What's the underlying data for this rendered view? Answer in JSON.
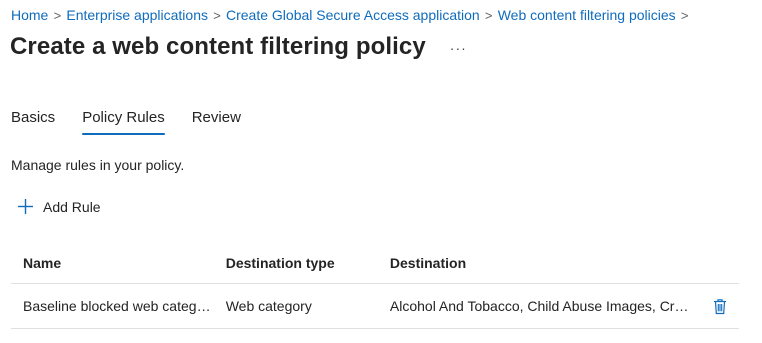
{
  "breadcrumb": {
    "items": [
      "Home",
      "Enterprise applications",
      "Create Global Secure Access application",
      "Web content filtering policies"
    ],
    "separator": ">"
  },
  "page": {
    "title": "Create a web content filtering policy",
    "more_label": "···"
  },
  "tabs": [
    {
      "label": "Basics",
      "active": false
    },
    {
      "label": "Policy Rules",
      "active": true
    },
    {
      "label": "Review",
      "active": false
    }
  ],
  "description": "Manage rules in your policy.",
  "toolbar": {
    "add_rule_label": "Add Rule",
    "add_icon": "plus-icon"
  },
  "table": {
    "columns": [
      "Name",
      "Destination type",
      "Destination"
    ],
    "rows": [
      {
        "name": "Baseline blocked web categories",
        "destination_type": "Web category",
        "destination": "Alcohol And Tobacco, Child Abuse Images, Crimin...",
        "action_icon": "trash-icon"
      }
    ]
  },
  "colors": {
    "accent": "#0f6cbd",
    "text": "#242424",
    "divider": "#e0e0e0"
  }
}
